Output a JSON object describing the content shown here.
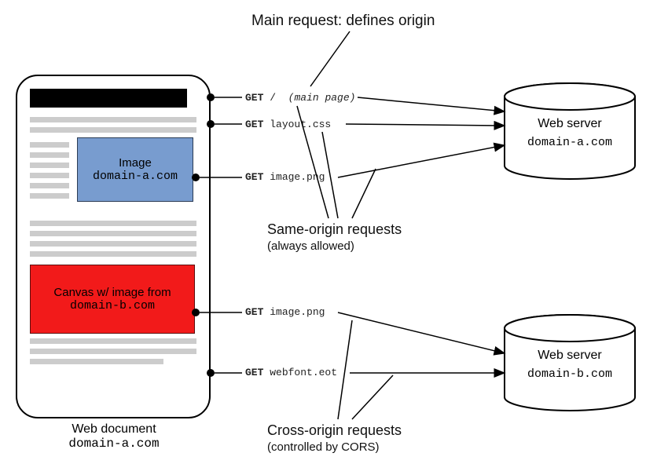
{
  "title_top": "Main request: defines origin",
  "document": {
    "image_label": "Image",
    "image_domain": "domain-a.com",
    "canvas_label": "Canvas w/ image from",
    "canvas_domain": "domain-b.com",
    "caption_text": "Web document",
    "caption_domain": "domain-a.com"
  },
  "requests": [
    {
      "verb": "GET",
      "path": "/",
      "note": "(main page)"
    },
    {
      "verb": "GET",
      "path": "layout.css",
      "note": ""
    },
    {
      "verb": "GET",
      "path": "image.png",
      "note": ""
    },
    {
      "verb": "GET",
      "path": "image.png",
      "note": ""
    },
    {
      "verb": "GET",
      "path": "webfont.eot",
      "note": ""
    }
  ],
  "section_same": {
    "title": "Same-origin requests",
    "sub": "(always allowed)"
  },
  "section_cross": {
    "title": "Cross-origin requests",
    "sub": "(controlled by CORS)"
  },
  "servers": {
    "a": {
      "label": "Web server",
      "domain": "domain-a.com"
    },
    "b": {
      "label": "Web server",
      "domain": "domain-b.com"
    }
  }
}
